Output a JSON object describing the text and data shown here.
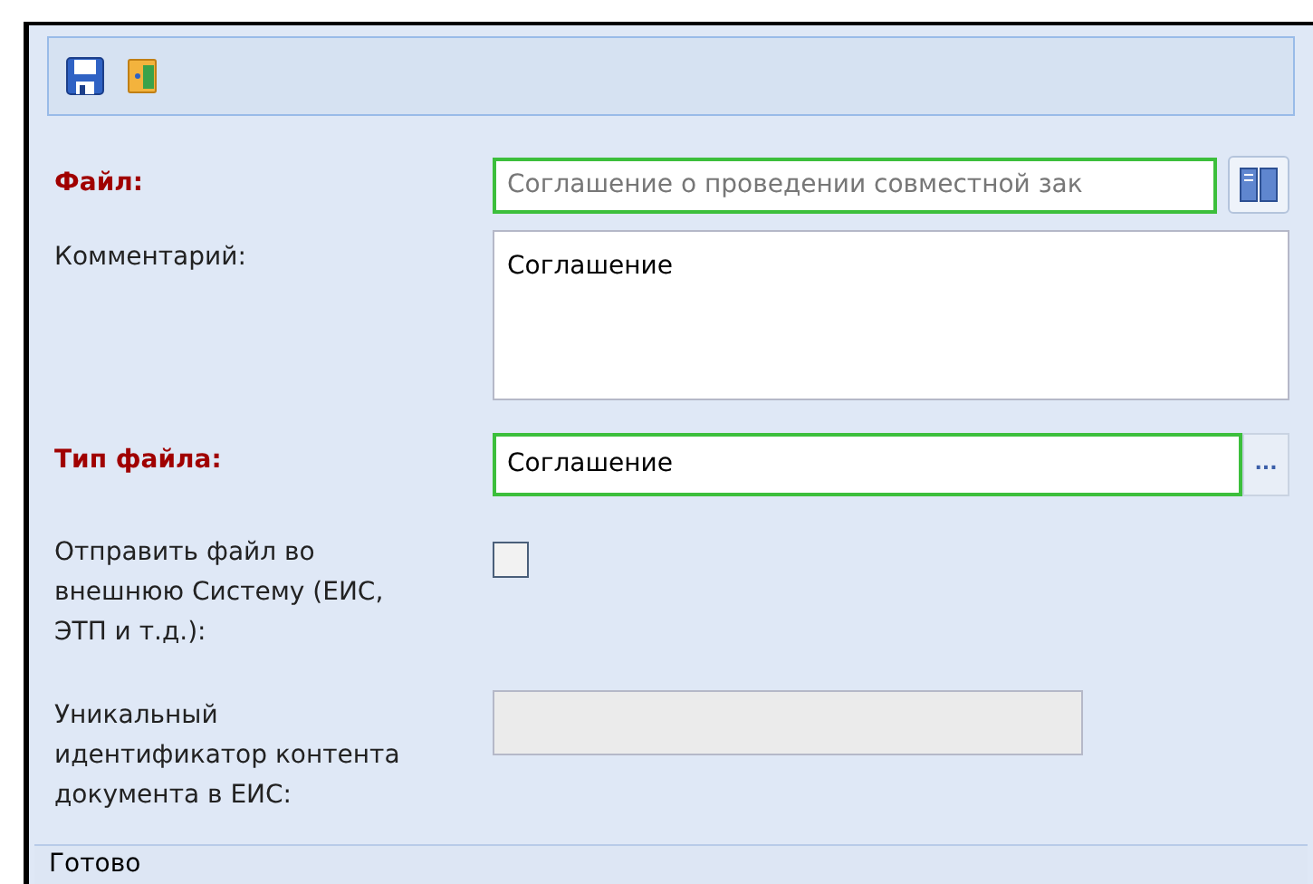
{
  "toolbar": {
    "buttons": [
      {
        "kind": "save"
      },
      {
        "kind": "exit"
      }
    ]
  },
  "form": {
    "fields": [
      {
        "label": "Файл:",
        "required": true,
        "kind": "file",
        "value": "Соглашение о проведении совместной зак",
        "readonly": true
      },
      {
        "label": "Комментарий:",
        "required": false,
        "kind": "textarea",
        "value": "Соглашение"
      },
      {
        "label": "Тип файла:",
        "required": true,
        "kind": "lookup",
        "value": "Соглашение",
        "button_text": "..."
      },
      {
        "label": "Отправить файл во внешнюю Систему (ЕИС, ЭТП и т.д.):",
        "required": false,
        "kind": "checkbox",
        "checked": false
      },
      {
        "label": "Уникальный идентификатор контента документа в ЕИС:",
        "required": false,
        "kind": "text",
        "disabled": true
      }
    ]
  },
  "status_bar": {
    "text": "Готово"
  }
}
